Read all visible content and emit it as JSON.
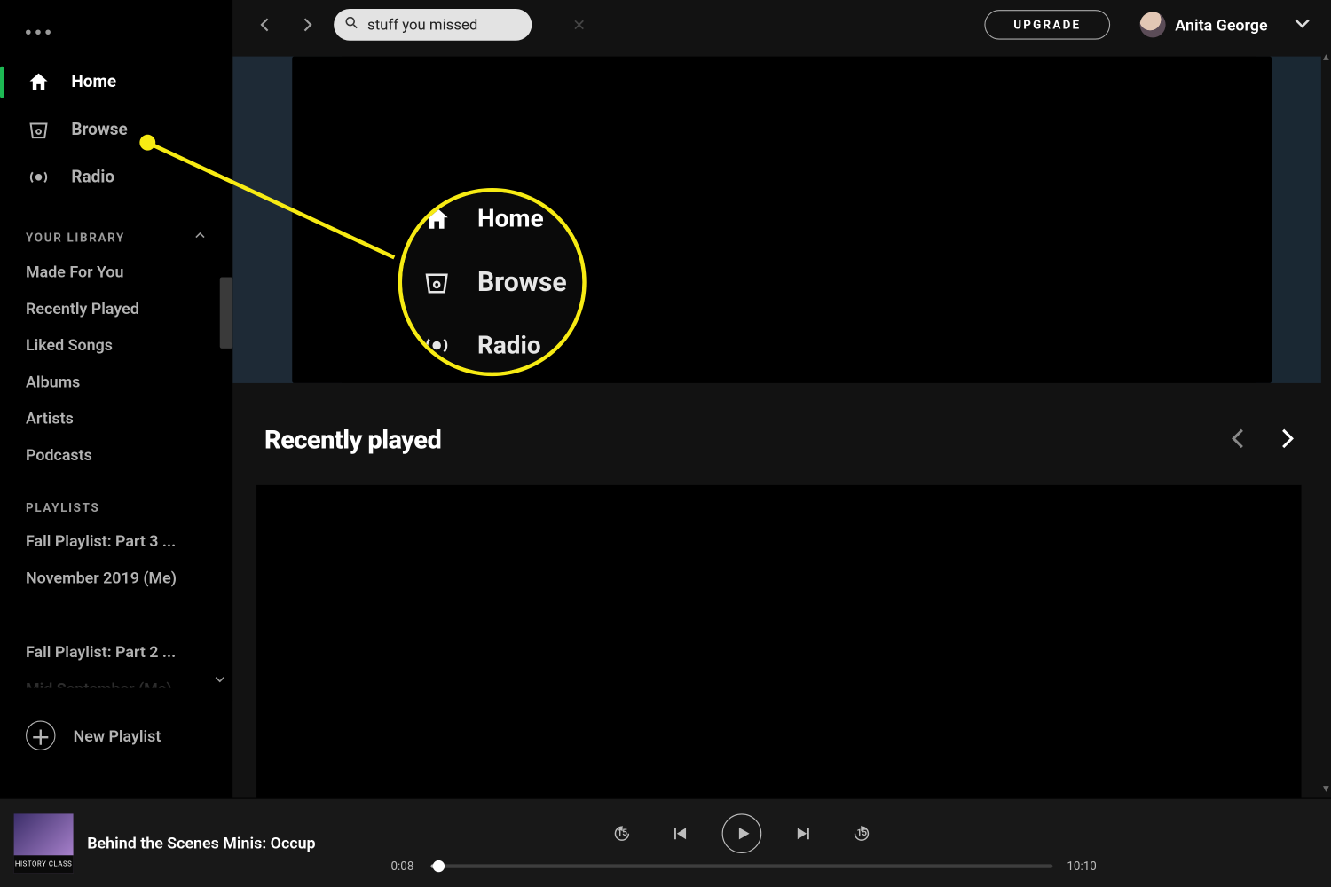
{
  "topbar": {
    "search_value": "stuff you missed",
    "upgrade_label": "UPGRADE",
    "user_name": "Anita George"
  },
  "sidebar": {
    "nav": {
      "home": "Home",
      "browse": "Browse",
      "radio": "Radio"
    },
    "library_header": "YOUR LIBRARY",
    "library_items": {
      "made": "Made For You",
      "recent": "Recently Played",
      "liked": "Liked Songs",
      "albums": "Albums",
      "artists": "Artists",
      "podcasts": "Podcasts"
    },
    "playlists_header": "PLAYLISTS",
    "playlists": {
      "p1": "Fall Playlist: Part 3 ...",
      "p2": "November 2019 (Me)",
      "p3": "Fall Playlist: Part 2 ...",
      "p4": "Mid September (Me)"
    },
    "new_playlist_label": "New Playlist"
  },
  "main": {
    "recently_played_title": "Recently played"
  },
  "callout": {
    "home": "Home",
    "browse": "Browse",
    "radio": "Radio"
  },
  "player": {
    "track_title": "Behind the Scenes Minis: Occup",
    "art_label": "HISTORY CLASS",
    "elapsed": "0:08",
    "duration": "10:10",
    "skip_back": "15",
    "skip_fwd": "15"
  }
}
